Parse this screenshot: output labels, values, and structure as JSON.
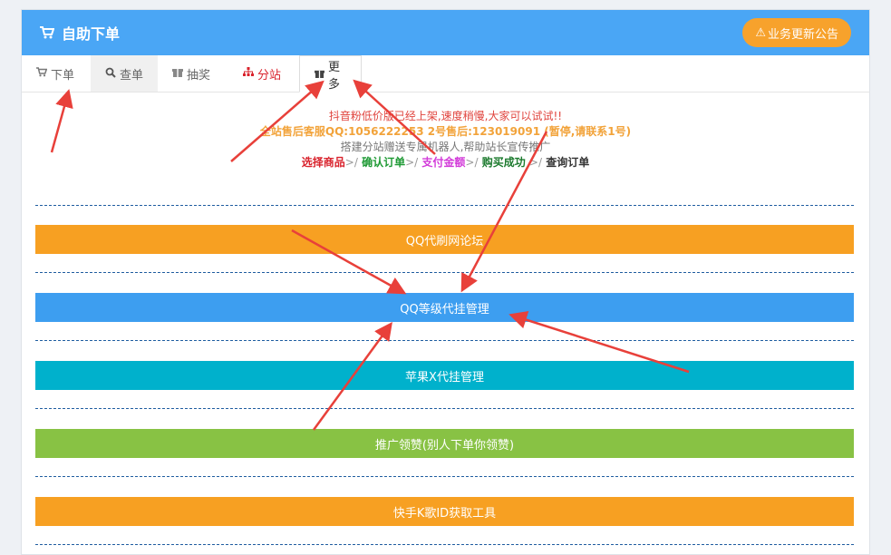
{
  "header": {
    "title": "自助下单",
    "notice_button": "业务更新公告"
  },
  "tabs": [
    {
      "label": "下单",
      "icon": "cart-icon"
    },
    {
      "label": "查单",
      "icon": "search-icon"
    },
    {
      "label": "抽奖",
      "icon": "gift-icon"
    },
    {
      "label": "分站",
      "icon": "sitemap-icon"
    },
    {
      "label": "更多",
      "icon": "gift-icon"
    }
  ],
  "notice": {
    "line1": "抖音粉低价版已经上架,速度稍慢,大家可以试试!!",
    "line2": "全站售后客服QQ:1056222253 2号售后:123019091 (暂停,请联系1号)",
    "line3": "搭建分站赠送专属机器人,帮助站长宣传推广",
    "steps": [
      "选择商品",
      "确认订单",
      "支付金额",
      "购买成功",
      "查询订单"
    ],
    "step_sep": ">/"
  },
  "categories": [
    {
      "label": "QQ代刷网论坛",
      "color": "#f7a022"
    },
    {
      "label": "QQ等级代挂管理",
      "color": "#3d9ef0"
    },
    {
      "label": "苹果X代挂管理",
      "color": "#00b1cc"
    },
    {
      "label": "推广领赞(别人下单你领赞)",
      "color": "#88c244"
    },
    {
      "label": "快手K歌ID获取工具",
      "color": "#f7a022"
    }
  ],
  "colors": {
    "header_bg": "#4aa6f5",
    "notice_button_bg": "#f7a22c",
    "annotation_arrow": "#e8403a"
  }
}
